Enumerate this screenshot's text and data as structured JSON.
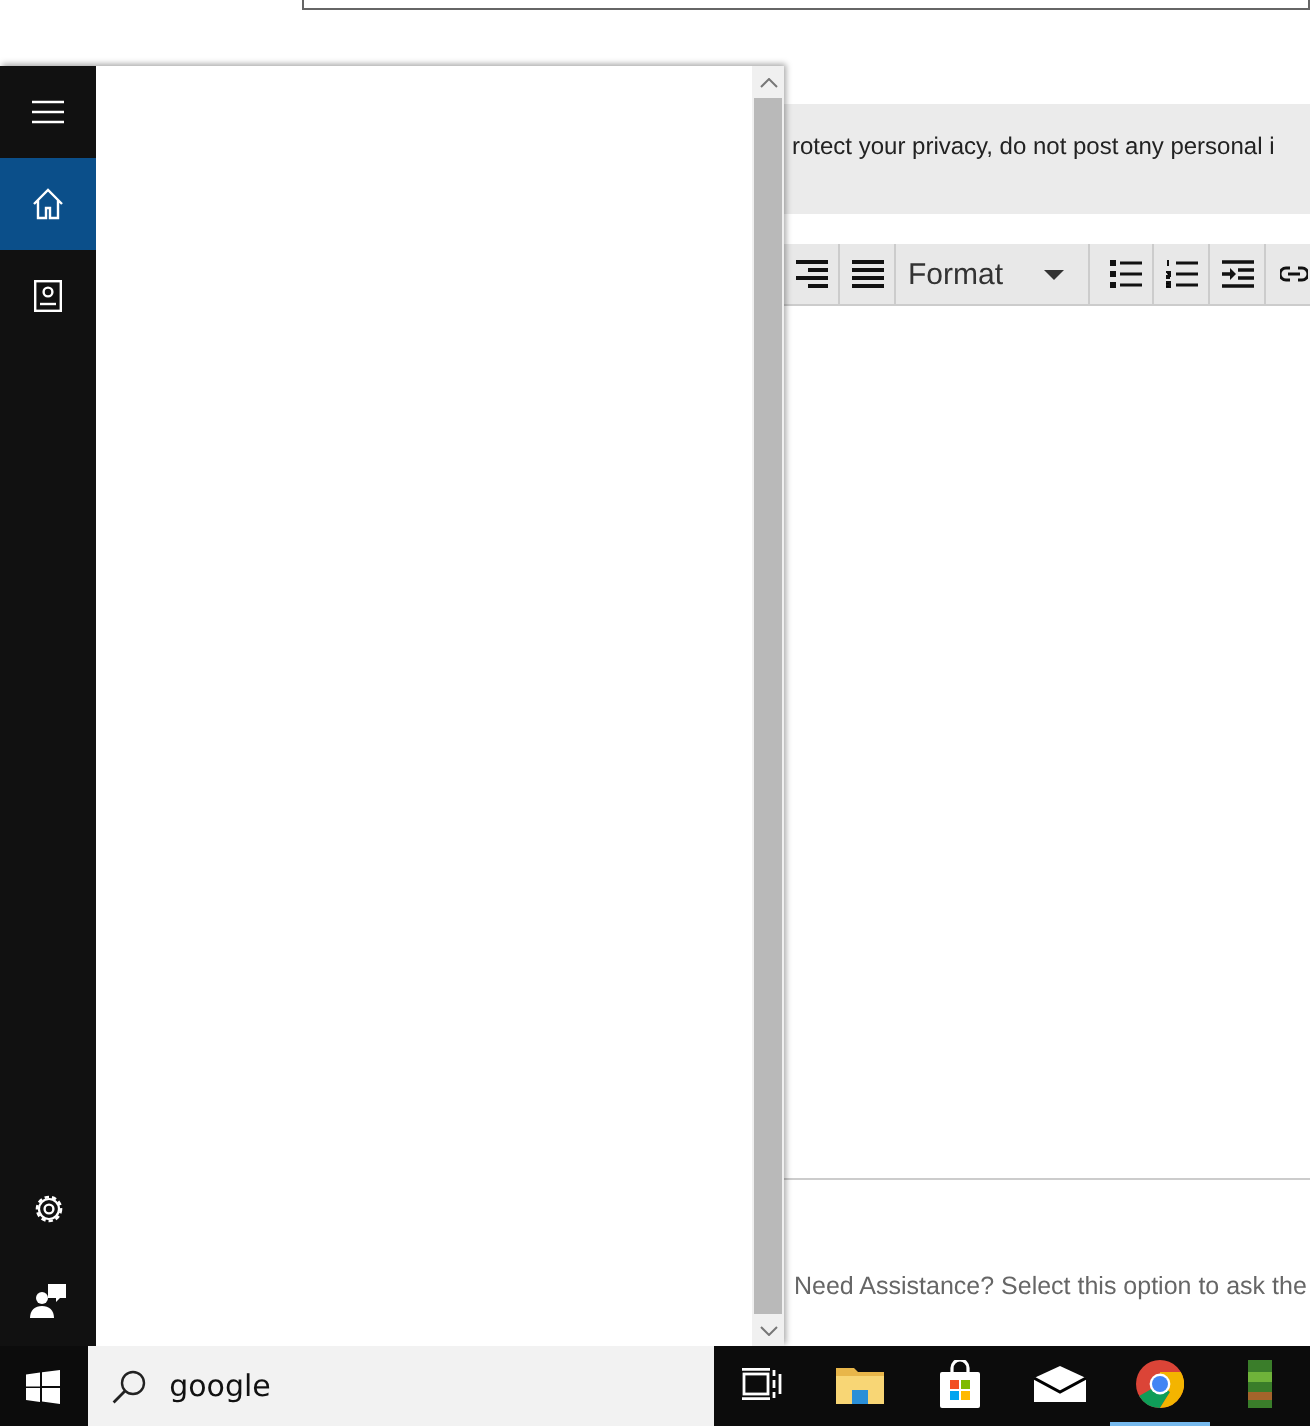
{
  "page": {
    "privacy_notice": "rotect your privacy, do not post any personal i",
    "toolbar": [
      {
        "kind": "align-right"
      },
      {
        "kind": "justify"
      },
      {
        "kind": "dropdown",
        "label": "Format"
      },
      {
        "kind": "bullets"
      },
      {
        "kind": "numbering"
      },
      {
        "kind": "indent"
      },
      {
        "kind": "link"
      }
    ],
    "assistance_text": "Need Assistance? Select this option to ask the"
  },
  "start_panel": {
    "rail_items": [
      {
        "kind": "menu",
        "selected": false
      },
      {
        "kind": "home",
        "selected": true
      },
      {
        "kind": "notebook",
        "selected": false
      }
    ],
    "rail_bottom": [
      {
        "kind": "settings"
      },
      {
        "kind": "feedback"
      }
    ]
  },
  "taskbar": {
    "search": {
      "value": "google"
    },
    "apps": [
      {
        "kind": "task-view",
        "running": false
      },
      {
        "kind": "folder",
        "running": false
      },
      {
        "kind": "store",
        "running": false
      },
      {
        "kind": "mail",
        "running": false
      },
      {
        "kind": "browser",
        "running": true
      },
      {
        "kind": "game",
        "running": false
      }
    ]
  }
}
